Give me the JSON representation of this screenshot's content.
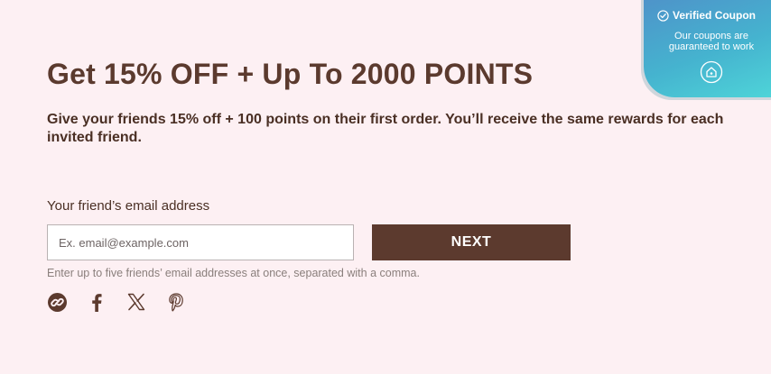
{
  "referral": {
    "headline": "Get 15% OFF + Up To 2000 POINTS",
    "subheadline": "Give your friends 15% off + 100 points on their first order. You’ll receive the same rewards for each invited friend.",
    "email_label": "Your friend’s email address",
    "email_placeholder": "Ex. email@example.com",
    "email_value": "",
    "next_label": "NEXT",
    "helper_text": "Enter up to five friends’ email addresses at once, separated with a comma."
  },
  "share": {
    "icons": [
      "link-icon",
      "facebook-icon",
      "x-icon",
      "pinterest-icon"
    ]
  },
  "badge": {
    "title": "Verified Coupon",
    "body": "Our coupons are guaranteed to work"
  },
  "colors": {
    "background": "#fdf0f3",
    "brand_brown": "#5c3a2e",
    "badge_gradient_start": "#4f90c9",
    "badge_gradient_end": "#4fd7d9"
  }
}
